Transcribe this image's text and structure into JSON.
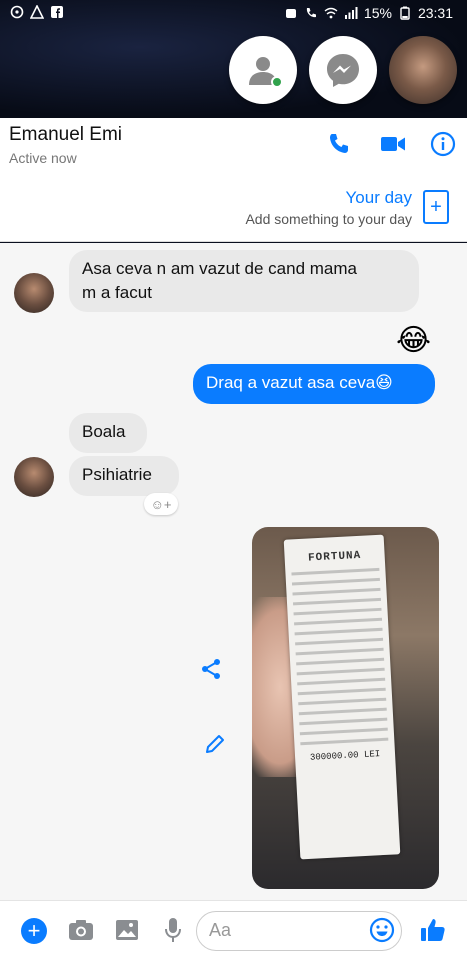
{
  "status_bar": {
    "battery": "15%",
    "time": "23:31"
  },
  "contact": {
    "name": "Emanuel Emi",
    "status": "Active now"
  },
  "your_day": {
    "title": "Your day",
    "subtitle": "Add something to your day"
  },
  "messages": {
    "m1": "Asa ceva n am vazut de cand mama",
    "m1b": "m a facut",
    "m2_emoji": "😂",
    "m3": "Draq a vazut asa ceva😆",
    "m4": "Boala",
    "m5": "Psihiatrie",
    "react_label": "☺+"
  },
  "receipt": {
    "brand": "FORTUNA",
    "amount": "300000.00 LEI"
  },
  "composer": {
    "placeholder": "Aa"
  },
  "colors": {
    "accent": "#0a7cff",
    "bubble_in": "#e9e9e9",
    "online": "#31a24c"
  },
  "icons": [
    "phone-icon",
    "video-icon",
    "info-icon",
    "plus-icon",
    "share-icon",
    "edit-icon",
    "camera-icon",
    "image-icon",
    "mic-icon",
    "emoji-icon",
    "like-icon"
  ]
}
